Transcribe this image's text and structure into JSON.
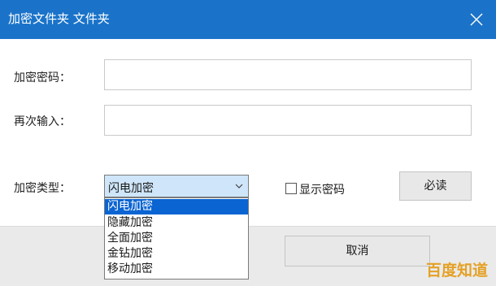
{
  "window": {
    "title": "加密文件夹 文件夹",
    "close_icon": "close-icon"
  },
  "form": {
    "password_label": "加密密码：",
    "password_value": "",
    "confirm_label": "再次输入：",
    "confirm_value": "",
    "type_label": "加密类型：",
    "type_selected": "闪电加密",
    "type_options": [
      "闪电加密",
      "隐藏加密",
      "全面加密",
      "金钻加密",
      "移动加密"
    ],
    "show_password_label": "显示密码",
    "show_password_checked": false,
    "must_read_button": "必读"
  },
  "footer": {
    "cancel_button": "取消"
  },
  "watermark": "百度知道",
  "colors": {
    "titlebar": "#1a73c9",
    "selected_item": "#0a64d2",
    "select_bg": "#cfe6fa"
  }
}
